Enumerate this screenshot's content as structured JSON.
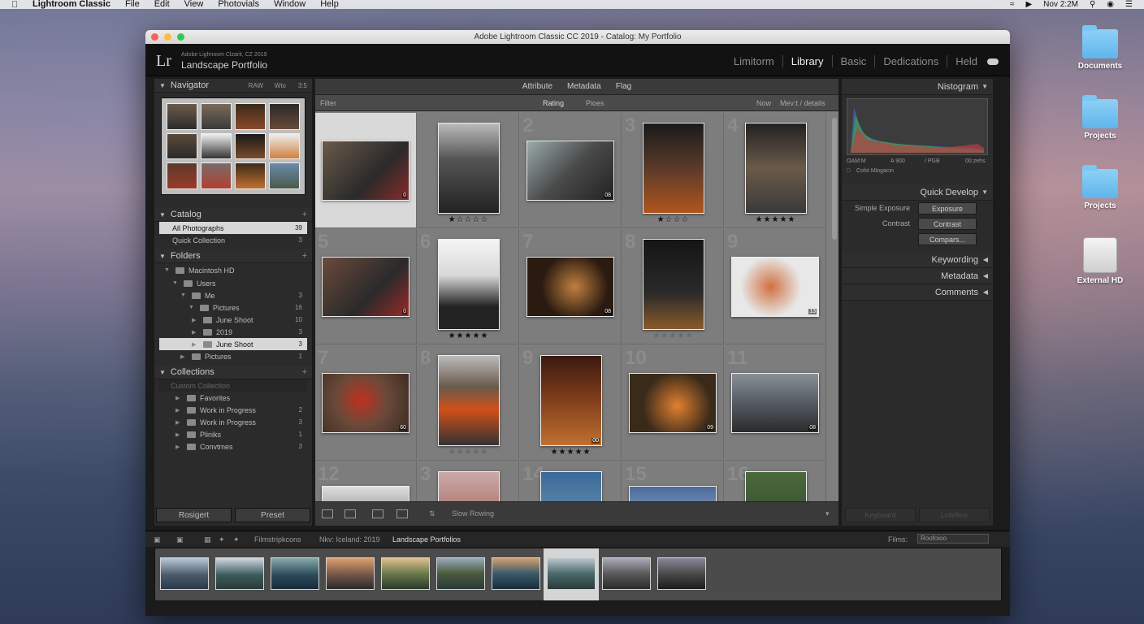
{
  "menubar": {
    "app": "Lightroom Classic",
    "items": [
      "File",
      "Edit",
      "View",
      "Photovials",
      "Window",
      "Help"
    ],
    "clock": "Nov 2:2M"
  },
  "desktop": {
    "icons": [
      "Documents",
      "Projects",
      "Projects",
      "External HD"
    ]
  },
  "window": {
    "title": "Adobe Lightroom Classic CC 2019 - Catalog: My Portfolio"
  },
  "header": {
    "logo": "Lr",
    "subtitle": "Adobe Lighnoom Clzarit, CZ 2019",
    "catalog_name": "Landscape Portfolio",
    "modules": [
      "Limitorm",
      "Library",
      "Basic",
      "Dedications",
      "Held"
    ],
    "active_module": "Library"
  },
  "left": {
    "navigator": {
      "label": "Navigator",
      "opt1": "RAW",
      "opt2": "Wto",
      "opt3": "3:5"
    },
    "catalog": {
      "label": "Catalog",
      "items": [
        {
          "label": "All Photographs",
          "count": "39"
        },
        {
          "label": "Quick Collection",
          "count": "3"
        }
      ]
    },
    "folders": {
      "label": "Folders",
      "drive": "Macintosh HD",
      "items": [
        {
          "label": "Users",
          "count": ""
        },
        {
          "label": "Me",
          "count": "3"
        },
        {
          "label": "Pictures",
          "count": "16"
        },
        {
          "label": "June Shoot",
          "count": "10"
        },
        {
          "label": "2019",
          "count": "3"
        },
        {
          "label": "June Shoot",
          "count": "3"
        },
        {
          "label": "Pictures",
          "count": "1"
        }
      ]
    },
    "collections": {
      "label": "Collections",
      "search": "Custom Collection",
      "items": [
        {
          "label": "Favorites",
          "count": ""
        },
        {
          "label": "Work in Progress",
          "count": "2"
        },
        {
          "label": "Work in Progress",
          "count": "3"
        },
        {
          "label": "Pliniks",
          "count": "1"
        },
        {
          "label": "Convtmes",
          "count": "3"
        }
      ]
    },
    "buttons": {
      "import": "Rosigert",
      "export": "Preset"
    }
  },
  "center": {
    "toolbar_tabs": [
      "Attribute",
      "Metadata",
      "Flag"
    ],
    "filter": "Filter",
    "rating": "Rating",
    "picks": "Pioes",
    "now": "Now",
    "sort": "Mev:t / details",
    "cells": [
      {
        "num": "",
        "stars": "",
        "badge": "0"
      },
      {
        "num": "",
        "stars": "★☆☆☆☆",
        "badge": ""
      },
      {
        "num": "2",
        "stars": "",
        "badge": "08"
      },
      {
        "num": "3",
        "stars": "★☆☆☆",
        "badge": ""
      },
      {
        "num": "4",
        "stars": "★★★★★",
        "badge": ""
      },
      {
        "num": "5",
        "stars": "",
        "badge": "0"
      },
      {
        "num": "6",
        "stars": "★★★★★",
        "badge": ""
      },
      {
        "num": "7",
        "stars": "",
        "badge": "08"
      },
      {
        "num": "8",
        "stars": "★★★★★",
        "badge": ""
      },
      {
        "num": "9",
        "stars": "",
        "badge": "13"
      },
      {
        "num": "7",
        "stars": "",
        "badge": "60"
      },
      {
        "num": "8",
        "stars": "★★★★★",
        "badge": ""
      },
      {
        "num": "9",
        "stars": "★★★★★",
        "badge": "00"
      },
      {
        "num": "10",
        "stars": "",
        "badge": "09"
      },
      {
        "num": "11",
        "stars": "",
        "badge": "08"
      },
      {
        "num": "12",
        "stars": "",
        "badge": ""
      },
      {
        "num": "3",
        "stars": "",
        "badge": ""
      },
      {
        "num": "14",
        "stars": "",
        "badge": ""
      },
      {
        "num": "15",
        "stars": "",
        "badge": ""
      },
      {
        "num": "16",
        "stars": "",
        "badge": ""
      }
    ],
    "bottom": {
      "sort_label": "Slow Rowing"
    }
  },
  "right": {
    "histogram": {
      "label": "Nistogram",
      "iso": "OAM:M",
      "focal": "A 900",
      "aperture": "/ PGB",
      "shutter": "00:zehs",
      "original": "Colst Mlogacin"
    },
    "quick_develop": {
      "label": "Quick Develop",
      "rows": [
        {
          "label": "Simple Exposure",
          "button": "Exposure"
        },
        {
          "label": "Contrast",
          "button": "Contrast"
        },
        {
          "label": "",
          "button": "Compars..."
        }
      ]
    },
    "keywording": "Keywording",
    "metadata": "Metadata",
    "comments": "Comments",
    "buttons": {
      "sync": "Keyboard",
      "sync2": "Loteflins"
    }
  },
  "filmbar": {
    "source": "Filmstripkcons",
    "path": "Nkv: Iceland: 2019",
    "collection": "Landscape Portfolios",
    "filter_label": "Films:",
    "filter_value": "Roofoioo"
  },
  "colors": {
    "accent": "#d9d9d9",
    "panel": "#2b2b2b",
    "grid": "#7f7f7f"
  }
}
